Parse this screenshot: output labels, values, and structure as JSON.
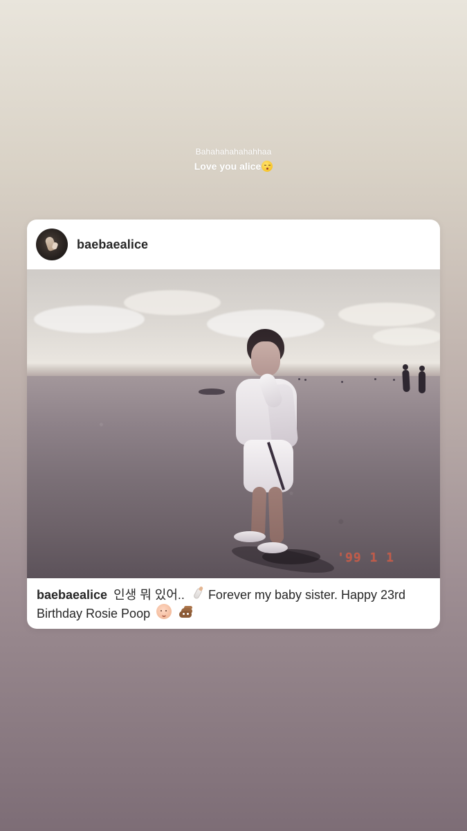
{
  "story": {
    "line1": "Bahahahahahahhaa",
    "line2": "Love you alice",
    "line2_emoji": "kissing-face-icon"
  },
  "post": {
    "username": "baebaealice",
    "avatar_icon": "profile-avatar",
    "photo_date_stamp": "'99 1 1",
    "caption": {
      "user": "baebaealice",
      "text_korean": "인생 뭐 있어..",
      "text_main": "Forever my baby sister. Happy 23rd Birthday Rosie Poop",
      "emoji1": "baby-bottle-icon",
      "emoji2": "baby-face-icon",
      "emoji3": "poop-icon"
    }
  },
  "colors": {
    "card_bg": "#ffffff",
    "text_primary": "#262626",
    "date_stamp": "#d35b44"
  }
}
